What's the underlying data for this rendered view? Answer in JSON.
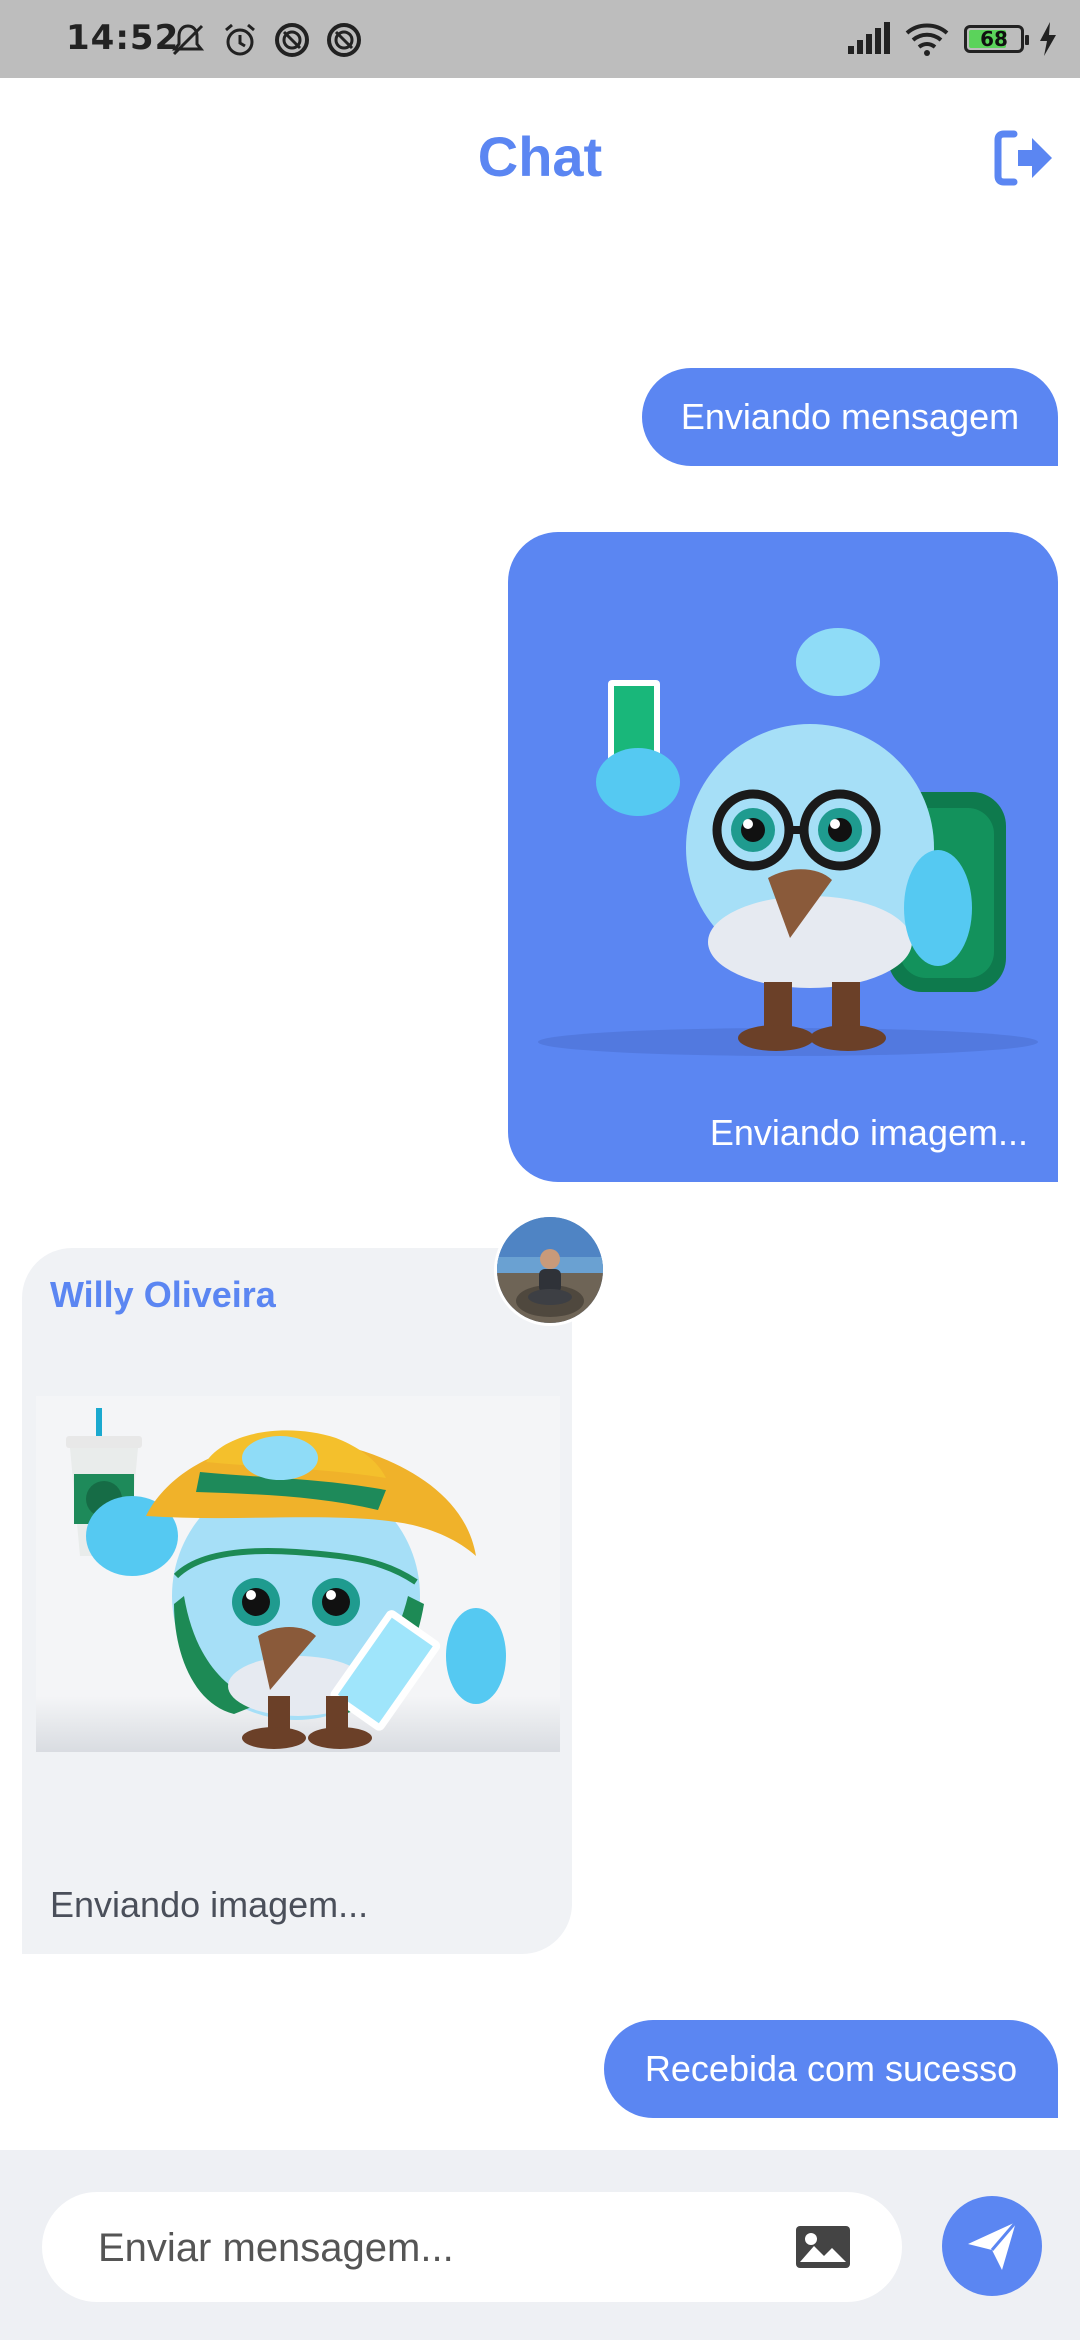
{
  "status": {
    "time": "14:52",
    "battery": "68",
    "left_icons": [
      "mute-bell-icon",
      "alarm-icon",
      "blocked-icon",
      "blocked-icon"
    ],
    "right_icons": [
      "signal-icon",
      "wifi-icon",
      "battery-icon",
      "charging-icon"
    ]
  },
  "header": {
    "title": "Chat",
    "action_icon": "logout-icon"
  },
  "messages": [
    {
      "type": "text",
      "direction": "sent",
      "text": "Enviando mensagem"
    },
    {
      "type": "image",
      "direction": "sent",
      "caption": "Enviando imagem...",
      "image": "blue bird with glasses and backpack holding phone"
    },
    {
      "type": "image",
      "direction": "received",
      "sender": "Willy Oliveira",
      "caption": "Enviando imagem...",
      "image": "blue bird with hat holding cup and phone"
    },
    {
      "type": "text",
      "direction": "sent",
      "text": "Recebida com sucesso"
    }
  ],
  "composer": {
    "placeholder": "Enviar mensagem...",
    "gallery_icon": "image-icon",
    "send_icon": "send-icon"
  },
  "colors": {
    "accent": "#5b86f2",
    "received_bg": "#f0f2f5",
    "composer_bg": "#eef0f4",
    "status_bar": "#bdbdbd"
  }
}
